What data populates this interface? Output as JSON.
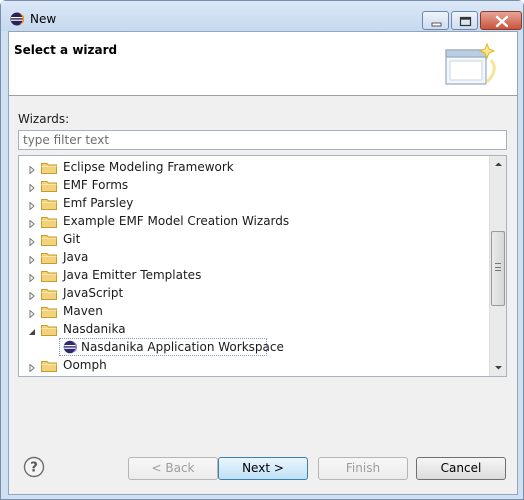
{
  "window": {
    "title": "New"
  },
  "banner": {
    "title": "Select a wizard"
  },
  "wizards_label": "Wizards:",
  "filter": {
    "placeholder": "type filter text",
    "value": ""
  },
  "tree": {
    "items": [
      {
        "label": "Eclipse Modeling Framework",
        "expanded": false
      },
      {
        "label": "EMF Forms",
        "expanded": false
      },
      {
        "label": "Emf Parsley",
        "expanded": false
      },
      {
        "label": "Example EMF Model Creation Wizards",
        "expanded": false
      },
      {
        "label": "Git",
        "expanded": false
      },
      {
        "label": "Java",
        "expanded": false
      },
      {
        "label": "Java Emitter Templates",
        "expanded": false
      },
      {
        "label": "JavaScript",
        "expanded": false
      },
      {
        "label": "Maven",
        "expanded": false
      },
      {
        "label": "Nasdanika",
        "expanded": true
      },
      {
        "label": "Oomph",
        "expanded": false
      }
    ],
    "selected_child": "Nasdanika Application Workspace"
  },
  "buttons": {
    "back": "< Back",
    "next": "Next >",
    "finish": "Finish",
    "cancel": "Cancel"
  },
  "colors": {
    "folder": "#e8c25a",
    "accent": "#3c7fb1"
  }
}
